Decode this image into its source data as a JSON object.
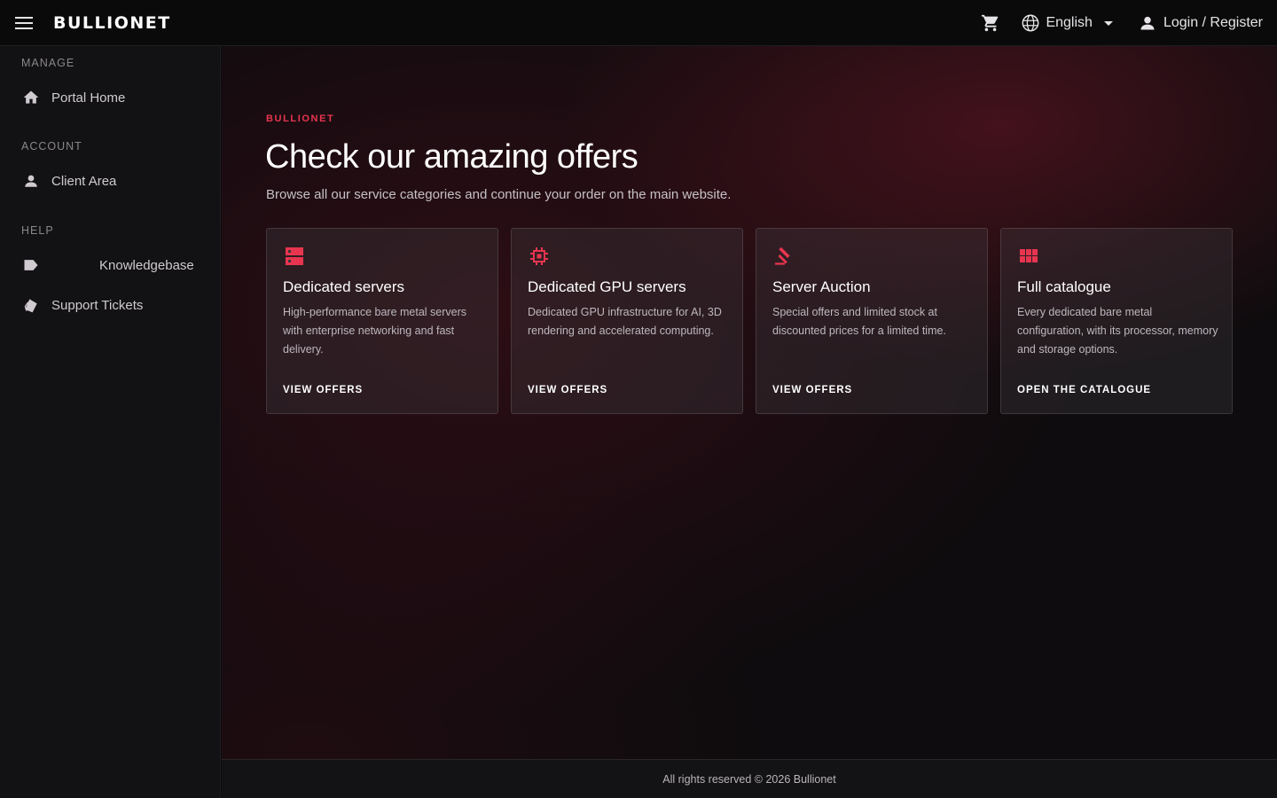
{
  "header": {
    "logo_text": "BULLIONET",
    "language_label": "English",
    "login_label": "Login / Register"
  },
  "sidebar": {
    "sections": [
      {
        "title": "MANAGE",
        "items": [
          {
            "label": "Portal Home",
            "icon": "home-icon"
          }
        ]
      },
      {
        "title": "ACCOUNT",
        "items": [
          {
            "label": "Client Area",
            "icon": "user-icon"
          }
        ]
      },
      {
        "title": "HELP",
        "items": [
          {
            "label": "Knowledgebase",
            "icon": "tag-icon"
          },
          {
            "label": "Support Tickets",
            "icon": "ticket-icon"
          }
        ]
      }
    ]
  },
  "main": {
    "eyebrow": "BULLIONET",
    "title": "Check our amazing offers",
    "subtitle": "Browse all our service categories and continue your order on the main website.",
    "cards": [
      {
        "title": "Dedicated servers",
        "description": "High-performance bare metal servers with enterprise networking and fast delivery.",
        "link": "VIEW OFFERS",
        "icon": "server-icon"
      },
      {
        "title": "Dedicated GPU servers",
        "description": "Dedicated GPU infrastructure for AI, 3D rendering and accelerated computing.",
        "link": "VIEW OFFERS",
        "icon": "chip-icon"
      },
      {
        "title": "Server Auction",
        "description": "Special offers and limited stock at discounted prices for a limited time.",
        "link": "VIEW OFFERS",
        "icon": "gavel-icon"
      },
      {
        "title": "Full catalogue",
        "description": "Every dedicated bare metal configuration, with its processor, memory and storage options.",
        "link": "OPEN THE CATALOGUE",
        "icon": "grid-icon"
      }
    ]
  },
  "footer": {
    "text": "All rights reserved © 2026 Bullionet"
  },
  "colors": {
    "accent": "#e8354f",
    "background": "#0d0c0e",
    "sidebar": "#121113"
  }
}
